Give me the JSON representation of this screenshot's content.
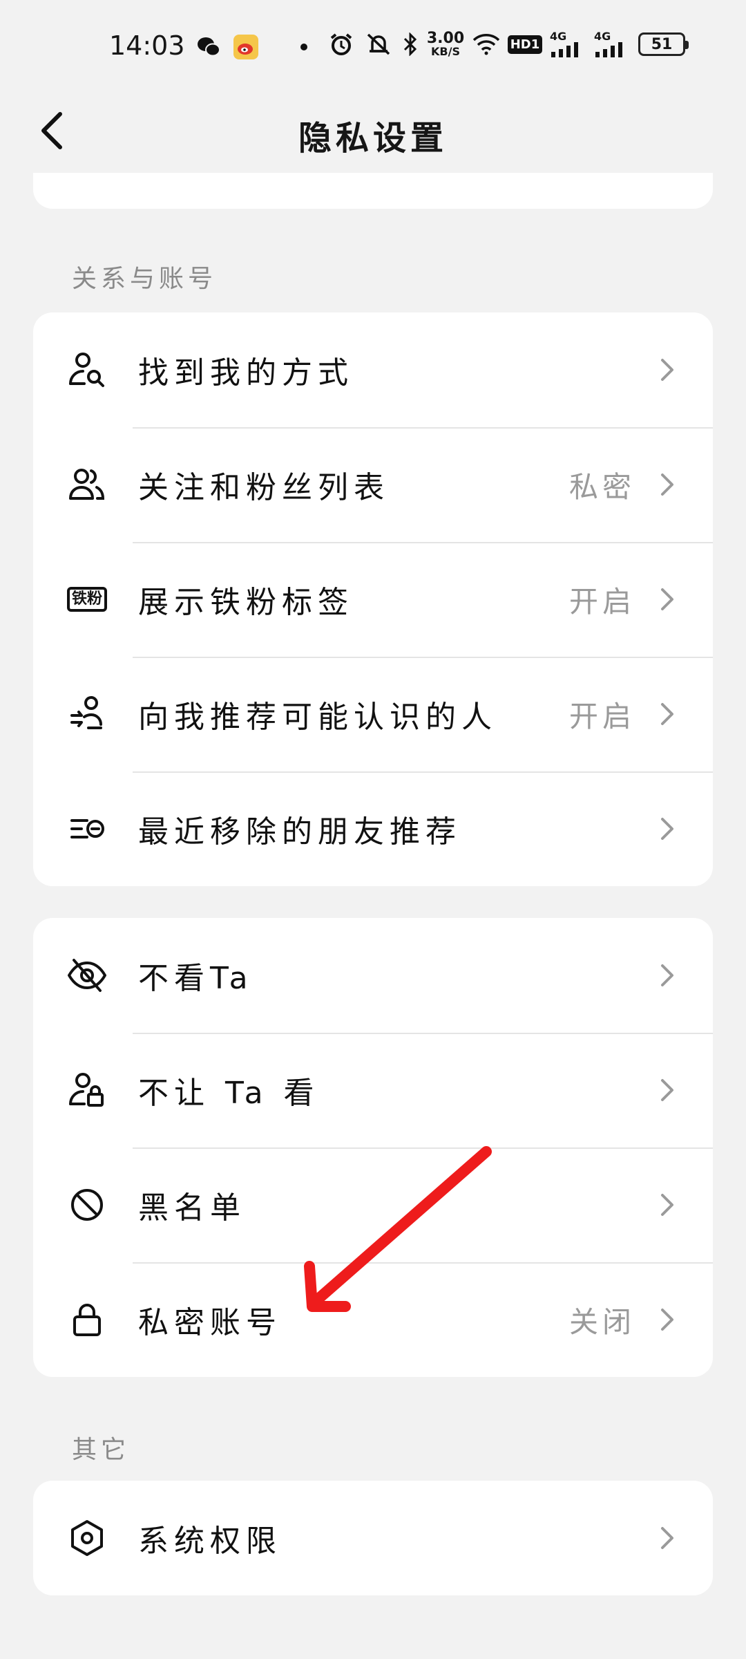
{
  "status_bar": {
    "time": "14:03",
    "net_speed_value": "3.00",
    "net_speed_unit": "KB/S",
    "hd_label": "HD1",
    "signal1_label": "4G",
    "signal2_label": "4G",
    "battery": "51",
    "icons": [
      "wechat-icon",
      "weibo-icon",
      "dot-icon",
      "alarm-icon",
      "mute-icon",
      "bluetooth-icon",
      "wifi-icon"
    ]
  },
  "header": {
    "title": "隐私设置"
  },
  "section_relation": {
    "label": "关系与账号",
    "items": [
      {
        "label": "找到我的方式",
        "value": "",
        "icon": "find-me-icon"
      },
      {
        "label": "关注和粉丝列表",
        "value": "私密",
        "icon": "followers-icon"
      },
      {
        "label": "展示铁粉标签",
        "value": "开启",
        "icon_text": "铁粉",
        "icon": "iron-fan-badge-icon"
      },
      {
        "label": "向我推荐可能认识的人",
        "value": "开启",
        "icon": "recommend-user-icon"
      },
      {
        "label": "最近移除的朋友推荐",
        "value": "",
        "icon": "removed-list-icon"
      }
    ]
  },
  "section_visibility": {
    "items": [
      {
        "label": "不看Ta",
        "value": "",
        "icon": "eye-off-icon"
      },
      {
        "label": "不让 Ta 看",
        "value": "",
        "icon": "user-lock-icon"
      },
      {
        "label": "黑名单",
        "value": "",
        "icon": "block-icon"
      },
      {
        "label": "私密账号",
        "value": "关闭",
        "icon": "lock-icon"
      }
    ]
  },
  "section_other": {
    "label": "其它",
    "items": [
      {
        "label": "系统权限",
        "value": "",
        "icon": "hexagon-settings-icon"
      }
    ]
  },
  "colors": {
    "background": "#f2f2f2",
    "card": "#ffffff",
    "annotation_arrow": "#ee1c1c",
    "value_text": "#9a9a9a"
  }
}
